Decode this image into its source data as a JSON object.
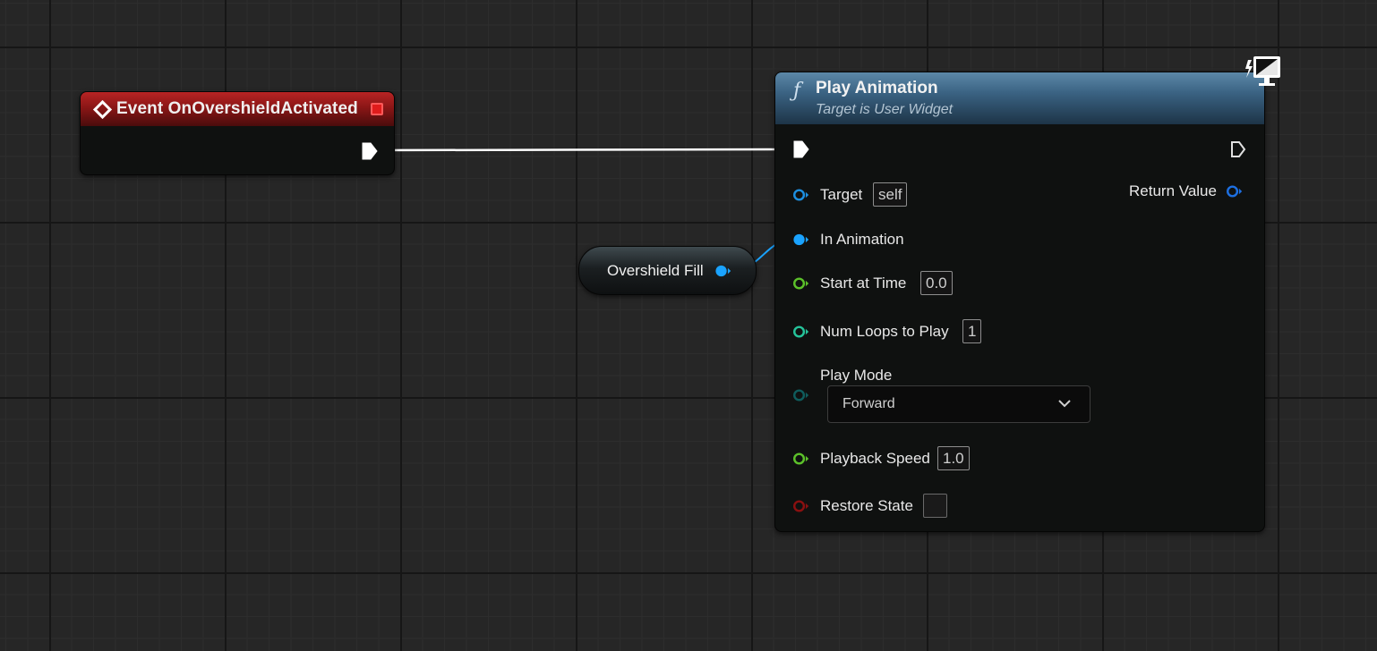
{
  "event_node": {
    "title": "Event OnOvershieldActivated",
    "header_color": "#9a1c1c",
    "icon": "event-diamond-icon"
  },
  "variable_node": {
    "title": "Overshield Fill",
    "pin_color": "#1aa3ff"
  },
  "function_node": {
    "title": "Play Animation",
    "subtitle": "Target is User Widget",
    "header_color": "#3a6282",
    "icon": "function-icon",
    "corner_icon": "monitor-icon",
    "inputs": {
      "target": {
        "label": "Target",
        "value": "self",
        "color": "#1d8fe0"
      },
      "in_animation": {
        "label": "In Animation",
        "color": "#1aa3ff"
      },
      "start_at_time": {
        "label": "Start at Time",
        "value": "0.0",
        "color": "#5cc12a"
      },
      "num_loops": {
        "label": "Num Loops to Play",
        "value": "1",
        "color": "#25c39a"
      },
      "play_mode": {
        "label": "Play Mode",
        "value": "Forward",
        "color": "#0f5c5c"
      },
      "playback_speed": {
        "label": "Playback Speed",
        "value": "1.0",
        "color": "#5cc12a"
      },
      "restore_state": {
        "label": "Restore State",
        "color": "#8a1010"
      }
    },
    "outputs": {
      "return_value": {
        "label": "Return Value",
        "color": "#1d6fe0"
      }
    }
  }
}
